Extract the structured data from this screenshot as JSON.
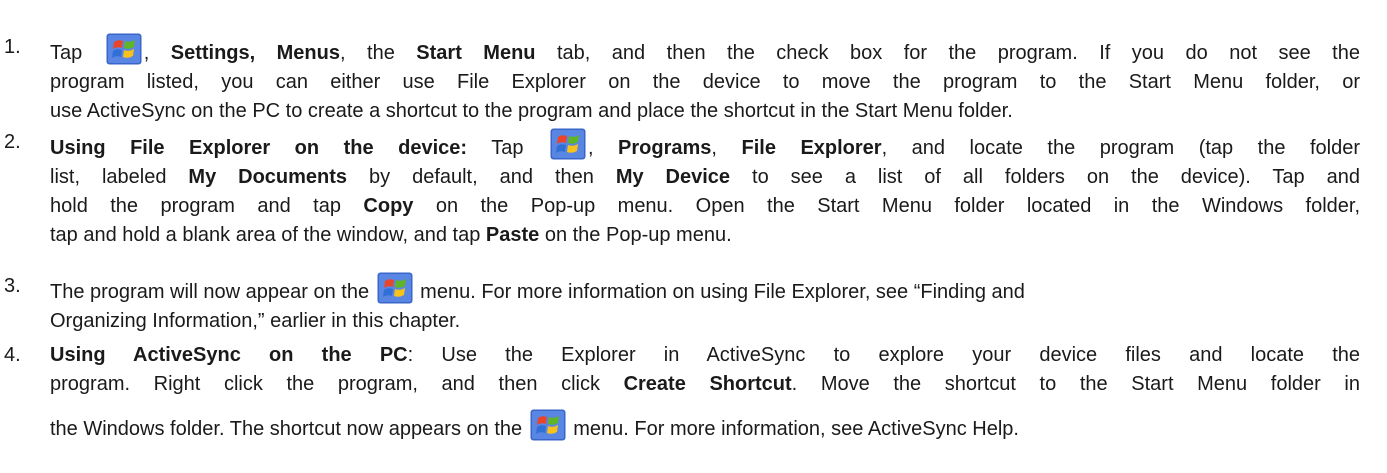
{
  "steps": [
    {
      "number": "1.",
      "t": {
        "a": "Tap ",
        "b": ", ",
        "c": "Settings, Menus",
        "d": ", the ",
        "e": "Start Menu",
        "f": " tab, and then the check box for the program. If you do not see the",
        "g": "program listed, you can either use File Explorer on the device to move the program to the Start Menu folder, or",
        "h": "use ActiveSync on the PC to create a shortcut to the program and place the shortcut in the Start Menu folder."
      }
    },
    {
      "number": "2.",
      "t": {
        "a": "Using File Explorer on the device:",
        "b": " Tap ",
        "c": ", ",
        "d": "Programs",
        "e": ", ",
        "f": "File Explorer",
        "g": ", and locate the program (tap the folder",
        "h": "list, labeled ",
        "i": "My Documents",
        "j": " by default, and then ",
        "k": "My Device",
        "l": " to see a list of all folders on the device). Tap and",
        "m": "hold the program and tap ",
        "n": "Copy",
        "o": " on the Pop-up menu. Open the Start Menu folder located in the Windows folder,",
        "p": "tap and hold a blank area of the window, and tap ",
        "q": "Paste",
        "r": " on the Pop-up menu."
      }
    },
    {
      "number": "3.",
      "t": {
        "a": "The program will now appear on the ",
        "b": " menu. For more information on using File Explorer, see “Finding and",
        "c": "Organizing Information,” earlier in this chapter."
      }
    },
    {
      "number": "4.",
      "t": {
        "a": "Using ActiveSync on the PC",
        "b": ": Use the Explorer in ActiveSync to explore your device files and locate the",
        "c": "program. Right click the program, and then click ",
        "d": "Create Shortcut",
        "e": ". Move the shortcut to the Start Menu folder in",
        "f": "the Windows folder. The shortcut now appears on the ",
        "g": " menu. For more information, see ActiveSync Help."
      }
    }
  ],
  "icons": {
    "start": "windows-start-flag-icon"
  },
  "colors": {
    "text": "#1a1a1a",
    "flag_red": "#e8452a",
    "flag_green": "#5fb526",
    "flag_blue": "#2f6fd6",
    "flag_yellow": "#f7c21b",
    "tile_blue": "#3a66c9"
  }
}
